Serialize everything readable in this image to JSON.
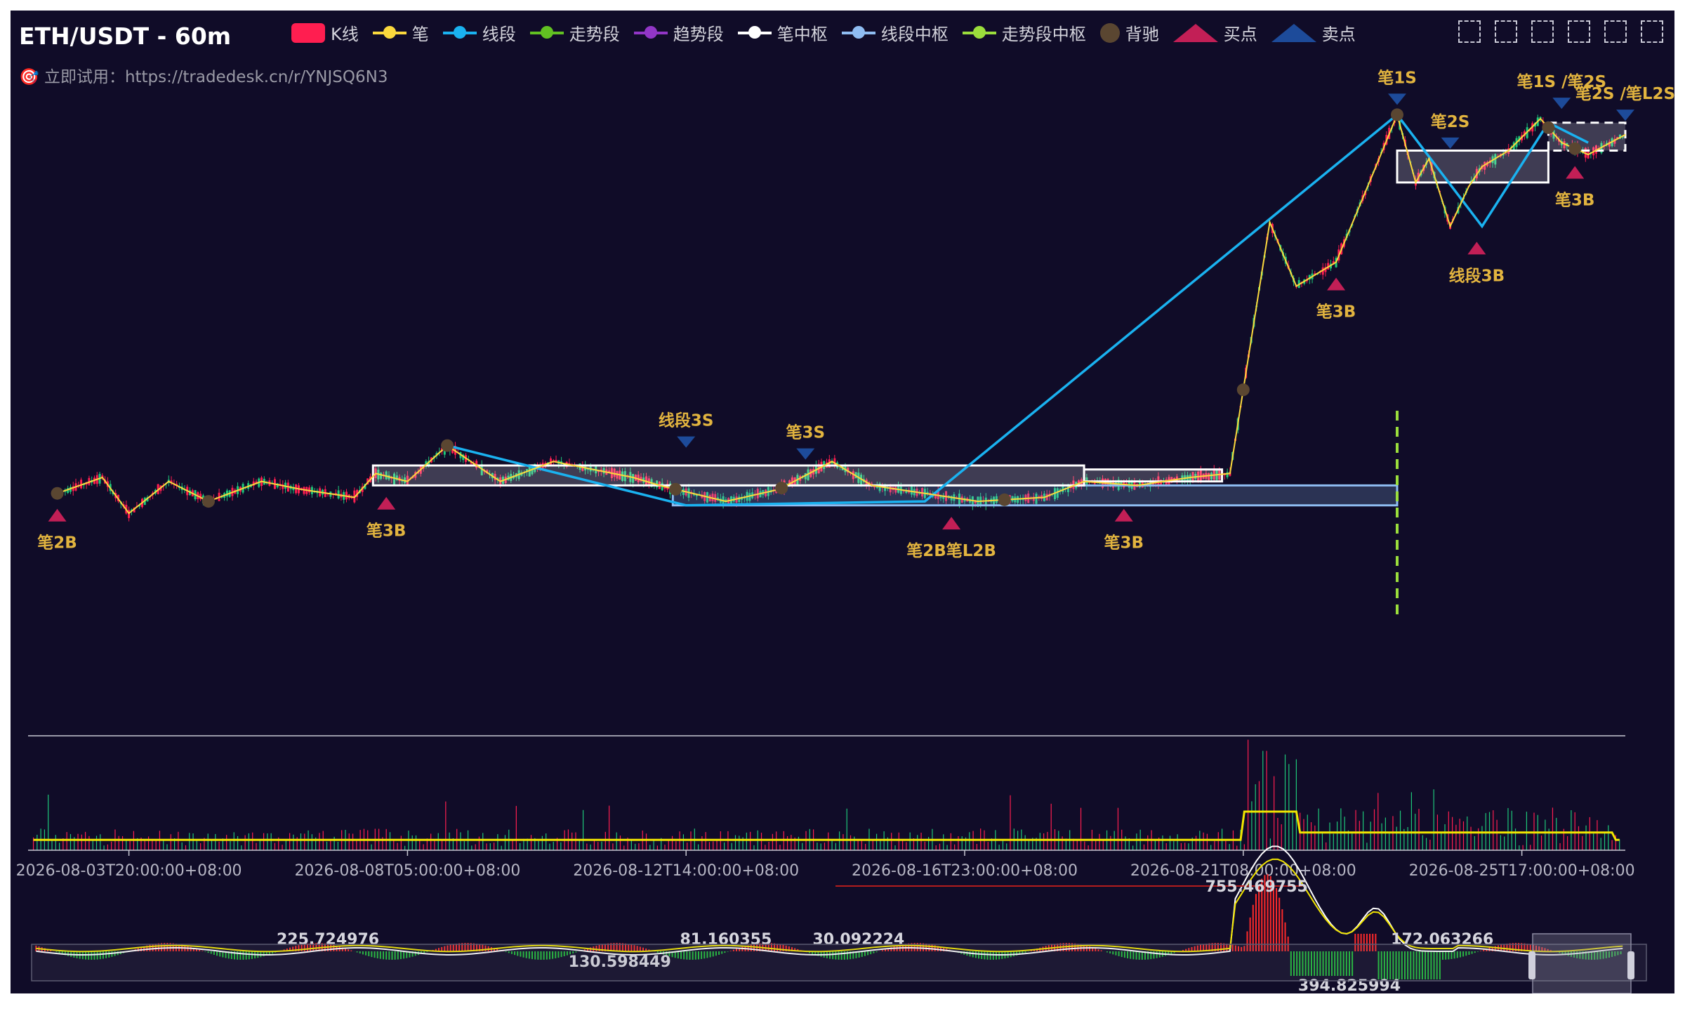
{
  "window_title": "ETH/USDT - 60m",
  "subtitle": "🎯 立即试用：https://tradedesk.cn/r/YNJSQ6N3",
  "legend": [
    {
      "label": "K线",
      "color": "#ff1e50",
      "shape": "rect"
    },
    {
      "label": "笔",
      "color": "#fbd93d",
      "shape": "line"
    },
    {
      "label": "线段",
      "color": "#1ab2f0",
      "shape": "line"
    },
    {
      "label": "走势段",
      "color": "#62c122",
      "shape": "line"
    },
    {
      "label": "趋势段",
      "color": "#9236c7",
      "shape": "line"
    },
    {
      "label": "笔中枢",
      "color": "#ffffff",
      "shape": "line"
    },
    {
      "label": "线段中枢",
      "color": "#8fbdf2",
      "shape": "line"
    },
    {
      "label": "走势段中枢",
      "color": "#9bde3c",
      "shape": "line"
    },
    {
      "label": "背驰",
      "color": "#5a4631",
      "shape": "circle"
    },
    {
      "label": "买点",
      "color": "#c21f56",
      "shape": "triangle-up"
    },
    {
      "label": "卖点",
      "color": "#1d4b9a",
      "shape": "triangle-down"
    }
  ],
  "toolbar_icons": [
    "rect-select-icon",
    "lasso-select-icon",
    "clear-select-icon",
    "zoom-icon",
    "restore-icon",
    "exit-icon"
  ],
  "colors": {
    "background": "#100c28",
    "up": "#ff1e50",
    "down": "#1ec87a",
    "bi": "#fbd93d",
    "xianduan": "#1ab2f0",
    "bi_zs": "#ffffff",
    "xd_zs": "#8fbdf2",
    "buy": "#c21f56",
    "sell": "#1d4b9a",
    "signal_label": "#e2b43f",
    "beichi": "#5a4631",
    "divider": "#9bde3c"
  },
  "chart_data": {
    "type": "candlestick",
    "symbol": "ETH/USDT",
    "interval": "60m",
    "x_tick_labels": [
      "2026-08-03T20:00:00+08:00",
      "2026-08-08T05:00:00+08:00",
      "2026-08-12T14:00:00+08:00",
      "2026-08-16T23:00:00+08:00",
      "2026-08-21T08:00:00+08:00",
      "2026-08-25T17:00:00+08:00"
    ],
    "x_tick_hours": [
      0,
      105,
      210,
      315,
      420,
      525
    ],
    "x_range_hours": [
      -38,
      564
    ],
    "y_range_level": [
      -0.55,
      1.0
    ],
    "bi_points": [
      [
        -27,
        0.0
      ],
      [
        -10,
        0.04
      ],
      [
        0,
        -0.05
      ],
      [
        15,
        0.03
      ],
      [
        30,
        -0.02
      ],
      [
        50,
        0.03
      ],
      [
        65,
        0.01
      ],
      [
        85,
        -0.01
      ],
      [
        93,
        0.05
      ],
      [
        105,
        0.03
      ],
      [
        120,
        0.12
      ],
      [
        140,
        0.03
      ],
      [
        160,
        0.08
      ],
      [
        190,
        0.04
      ],
      [
        200,
        0.02
      ],
      [
        225,
        -0.02
      ],
      [
        245,
        0.01
      ],
      [
        265,
        0.08
      ],
      [
        280,
        0.02
      ],
      [
        300,
        0.0
      ],
      [
        320,
        -0.02
      ],
      [
        345,
        -0.01
      ],
      [
        360,
        0.03
      ],
      [
        380,
        0.02
      ],
      [
        400,
        0.04
      ],
      [
        415,
        0.05
      ],
      [
        430,
        0.68
      ],
      [
        440,
        0.52
      ],
      [
        455,
        0.58
      ],
      [
        470,
        0.82
      ],
      [
        478,
        0.95
      ],
      [
        485,
        0.78
      ],
      [
        490,
        0.84
      ],
      [
        498,
        0.67
      ],
      [
        505,
        0.77
      ],
      [
        510,
        0.82
      ],
      [
        520,
        0.86
      ],
      [
        532,
        0.94
      ],
      [
        540,
        0.88
      ],
      [
        550,
        0.85
      ],
      [
        564,
        0.9
      ]
    ],
    "xd_points": [
      [
        120,
        0.12
      ],
      [
        210,
        -0.03
      ],
      [
        300,
        -0.02
      ],
      [
        478,
        0.95
      ],
      [
        510,
        0.67
      ],
      [
        535,
        0.93
      ],
      [
        550,
        0.88
      ]
    ],
    "bi_zhongshu": [
      {
        "from": 92,
        "to": 360,
        "low": 0.02,
        "high": 0.07
      },
      {
        "from": 360,
        "to": 412,
        "low": 0.03,
        "high": 0.06
      },
      {
        "from": 478,
        "to": 535,
        "low": 0.78,
        "high": 0.86
      },
      {
        "from": 535,
        "to": 564,
        "low": 0.86,
        "high": 0.93
      }
    ],
    "xd_zhongshu": [
      {
        "from": 205,
        "to": 478,
        "low": -0.03,
        "high": 0.02
      }
    ],
    "signals": [
      {
        "label": "笔2B",
        "hour": -27,
        "level": 0.0,
        "kind": "buy"
      },
      {
        "label": "笔3B",
        "hour": 97,
        "level": 0.03,
        "kind": "buy"
      },
      {
        "label": "线段3S",
        "hour": 210,
        "level": 0.09,
        "kind": "sell"
      },
      {
        "label": "笔3S",
        "hour": 255,
        "level": 0.06,
        "kind": "sell"
      },
      {
        "label": "笔2B笔L2B",
        "hour": 310,
        "level": -0.02,
        "kind": "buy"
      },
      {
        "label": "笔3B",
        "hour": 375,
        "level": 0.0,
        "kind": "buy"
      },
      {
        "label": "笔3B",
        "hour": 455,
        "level": 0.58,
        "kind": "buy"
      },
      {
        "label": "笔1S",
        "hour": 478,
        "level": 0.95,
        "kind": "sell"
      },
      {
        "label": "笔2S",
        "hour": 498,
        "level": 0.84,
        "kind": "sell"
      },
      {
        "label": "线段3B",
        "hour": 508,
        "level": 0.67,
        "kind": "buy"
      },
      {
        "label": "笔1S /笔2S",
        "hour": 540,
        "level": 0.94,
        "kind": "sell"
      },
      {
        "label": "笔3B",
        "hour": 545,
        "level": 0.86,
        "kind": "buy"
      },
      {
        "label": "笔2S /笔L2S",
        "hour": 564,
        "level": 0.91,
        "kind": "sell"
      }
    ],
    "beichi_hours": [
      -27,
      30,
      120,
      206,
      246,
      330,
      420,
      478,
      535,
      545
    ],
    "divider_hour": 478,
    "macd_labels": [
      {
        "text": "755.469755",
        "hour": 425,
        "pos": "top"
      },
      {
        "text": "225.724976",
        "hour": 75,
        "pos": "mid"
      },
      {
        "text": "81.160355",
        "hour": 225,
        "pos": "mid"
      },
      {
        "text": "30.092224",
        "hour": 275,
        "pos": "mid"
      },
      {
        "text": "130.598449",
        "hour": 185,
        "pos": "low"
      },
      {
        "text": "172.063266",
        "hour": 495,
        "pos": "mid"
      },
      {
        "text": "394.825994",
        "hour": 460,
        "pos": "bottom"
      }
    ],
    "macd_bars_series": "dif/dea/macd histogram",
    "volume_series": "volume with MA"
  }
}
